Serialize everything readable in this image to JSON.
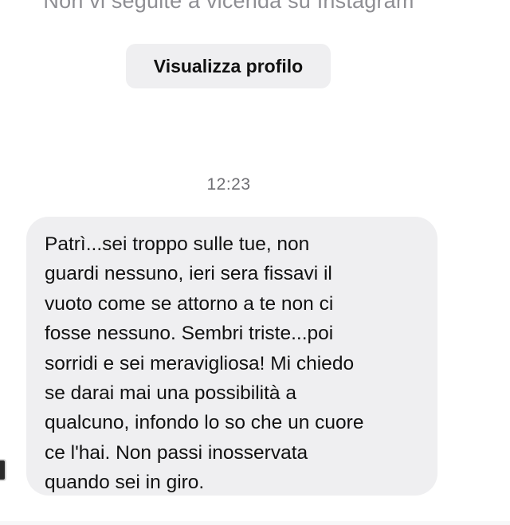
{
  "conversation": {
    "follow_status": "Non vi seguite a vicenda su Instagram",
    "view_profile_label": "Visualizza profilo",
    "timestamp": "12:23",
    "message": {
      "lines": [
        "Patrì...sei troppo sulle tue, non",
        "guardi nessuno, ieri sera fissavi il",
        "vuoto come se attorno a te non ci",
        "fosse nessuno. Sembri triste...poi",
        "sorridi e sei meravigliosa! Mi chiedo",
        "se darai mai una possibilità a",
        "qualcuno, infondo lo so che un cuore",
        "ce l'hai. Non passi inosservata",
        "quando sei in giro."
      ]
    }
  },
  "colors": {
    "background": "#ffffff",
    "bubble": "#efeff1",
    "secondary_text": "#8e8e93",
    "primary_text": "#111111"
  }
}
